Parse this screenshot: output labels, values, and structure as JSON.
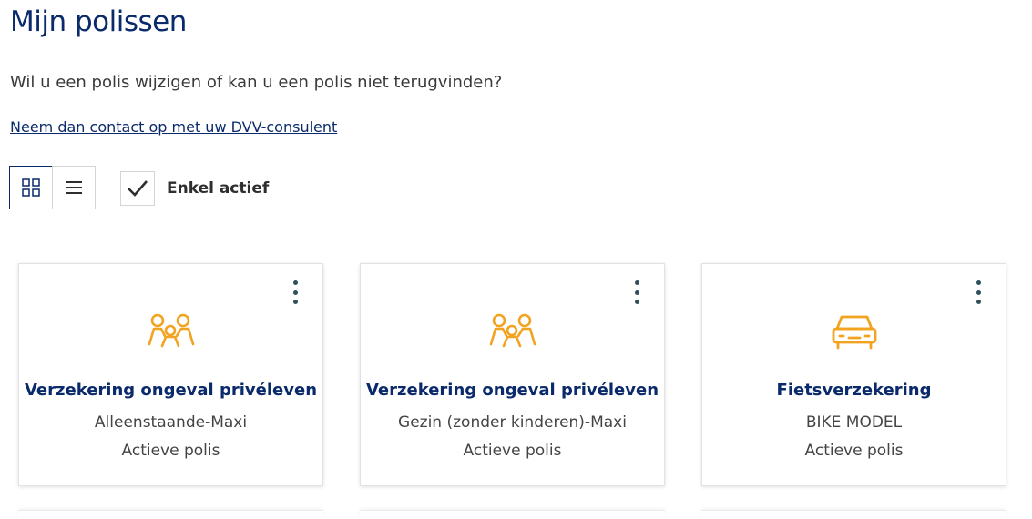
{
  "page": {
    "title": "Mijn polissen",
    "intro": "Wil u een polis wijzigen of kan u een polis niet terugvinden?",
    "contact_link": "Neem dan contact op met uw DVV-consulent"
  },
  "toolbar": {
    "view_modes": [
      {
        "name": "grid",
        "icon": "grid-icon",
        "active": true
      },
      {
        "name": "list",
        "icon": "list-icon",
        "active": false
      }
    ],
    "filter": {
      "label": "Enkel actief",
      "checked": true
    }
  },
  "colors": {
    "brand_navy": "#0a2a6b",
    "icon_orange": "#f2a31f",
    "kebab": "#2f4f5a"
  },
  "policies": [
    {
      "icon": "people-icon",
      "title": "Verzekering ongeval privéleven",
      "subtitle": "Alleenstaande-Maxi",
      "status": "Actieve polis"
    },
    {
      "icon": "people-icon",
      "title": "Verzekering ongeval privéleven",
      "subtitle": "Gezin (zonder kinderen)-Maxi",
      "status": "Actieve polis"
    },
    {
      "icon": "car-icon",
      "title": "Fietsverzekering",
      "subtitle": "BIKE MODEL",
      "status": "Actieve polis"
    }
  ]
}
